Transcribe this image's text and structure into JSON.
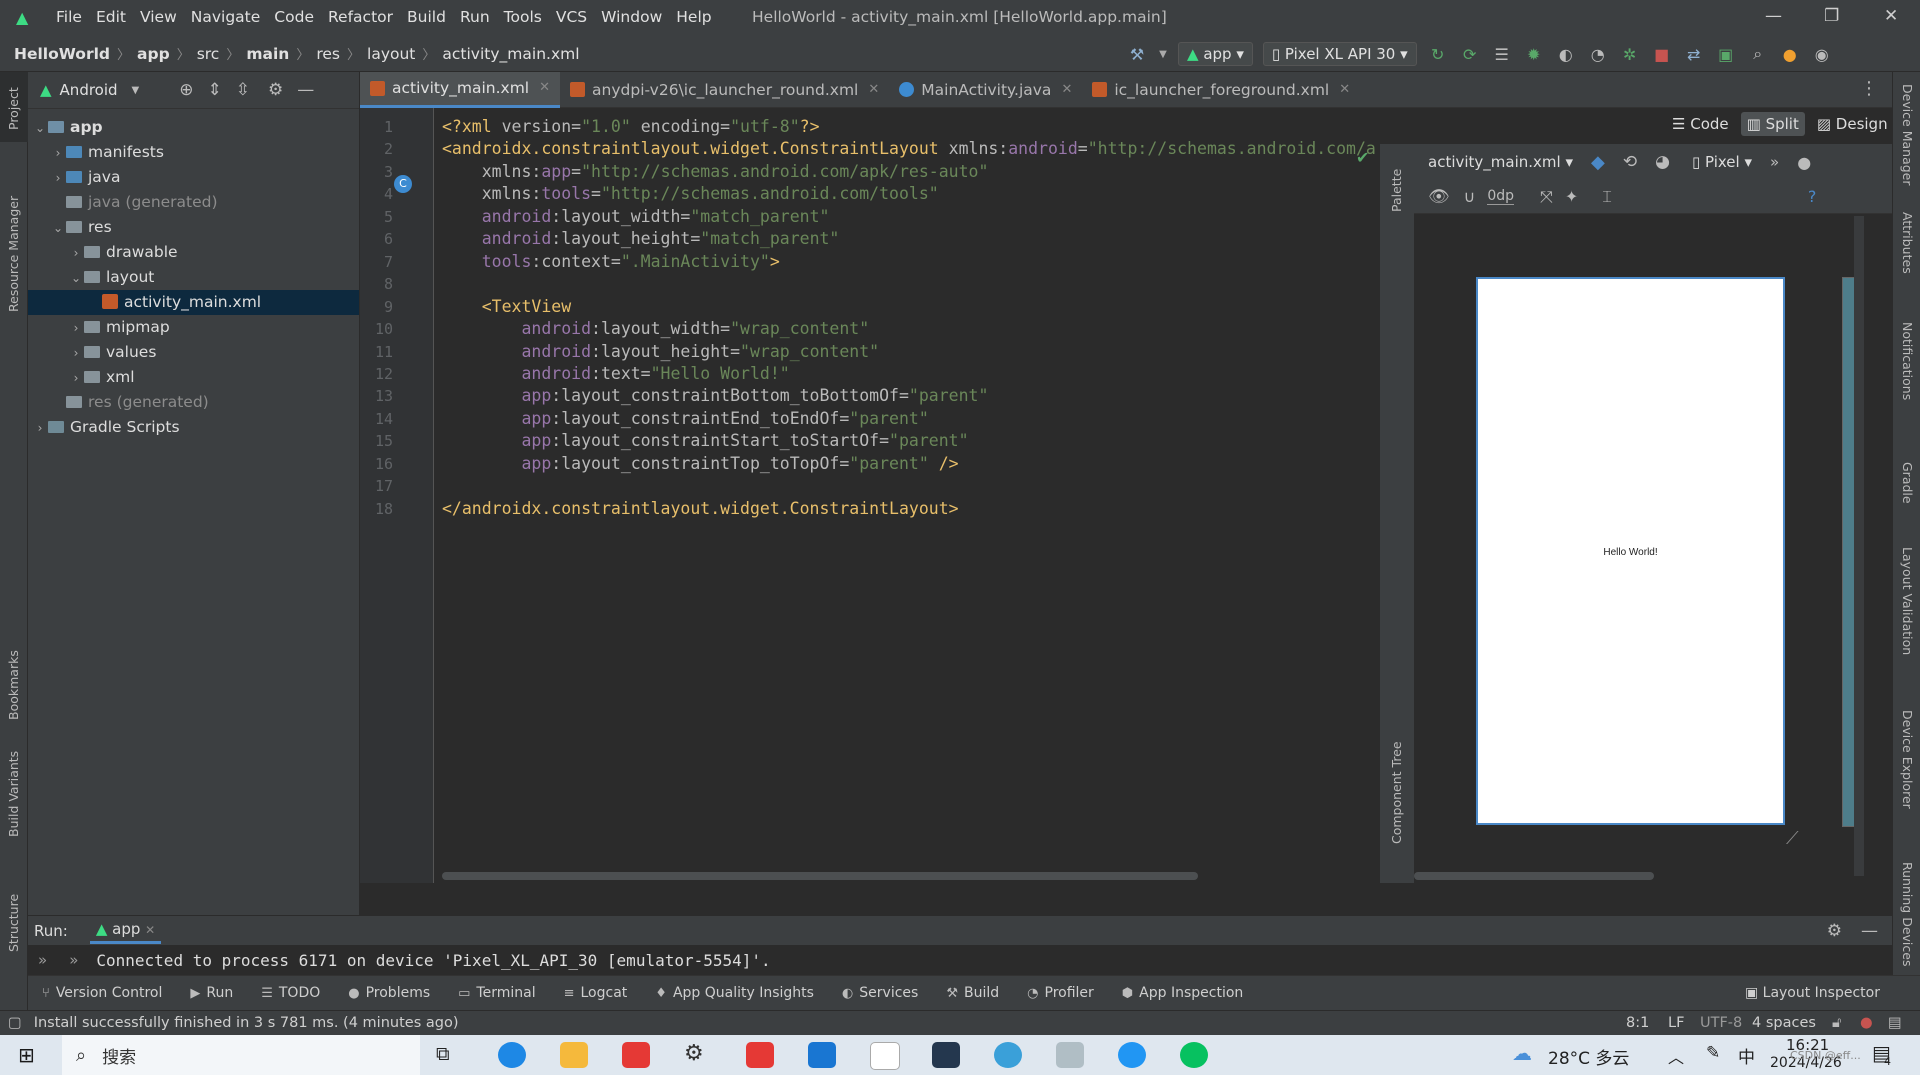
{
  "titlebar": {
    "menu": [
      "File",
      "Edit",
      "View",
      "Navigate",
      "Code",
      "Refactor",
      "Build",
      "Run",
      "Tools",
      "VCS",
      "Window",
      "Help"
    ],
    "title": "HelloWorld - activity_main.xml [HelloWorld.app.main]"
  },
  "breadcrumb": [
    "HelloWorld",
    "app",
    "src",
    "main",
    "res",
    "layout",
    "activity_main.xml"
  ],
  "toolbar": {
    "run_config": "app",
    "device": "Pixel XL API 30"
  },
  "project": {
    "view_label": "Android",
    "tree": [
      {
        "label": "app",
        "depth": 0,
        "chevron": "open",
        "kind": "module"
      },
      {
        "label": "manifests",
        "depth": 1,
        "chevron": "closed",
        "kind": "folder-blue"
      },
      {
        "label": "java",
        "depth": 1,
        "chevron": "closed",
        "kind": "folder-blue"
      },
      {
        "label": "java (generated)",
        "depth": 1,
        "chevron": "none",
        "kind": "folder-gen"
      },
      {
        "label": "res",
        "depth": 1,
        "chevron": "open",
        "kind": "folder"
      },
      {
        "label": "drawable",
        "depth": 2,
        "chevron": "closed",
        "kind": "folder"
      },
      {
        "label": "layout",
        "depth": 2,
        "chevron": "open",
        "kind": "folder"
      },
      {
        "label": "activity_main.xml",
        "depth": 3,
        "chevron": "none",
        "kind": "xml",
        "selected": true
      },
      {
        "label": "mipmap",
        "depth": 2,
        "chevron": "closed",
        "kind": "folder"
      },
      {
        "label": "values",
        "depth": 2,
        "chevron": "closed",
        "kind": "folder"
      },
      {
        "label": "xml",
        "depth": 2,
        "chevron": "closed",
        "kind": "folder"
      },
      {
        "label": "res (generated)",
        "depth": 1,
        "chevron": "none",
        "kind": "folder-gen"
      },
      {
        "label": "Gradle Scripts",
        "depth": 0,
        "chevron": "closed",
        "kind": "gradle"
      }
    ]
  },
  "tabs": [
    {
      "label": "activity_main.xml",
      "active": true,
      "icon": "xml"
    },
    {
      "label": "anydpi-v26\\ic_launcher_round.xml",
      "active": false,
      "icon": "xml"
    },
    {
      "label": "MainActivity.java",
      "active": false,
      "icon": "class"
    },
    {
      "label": "ic_launcher_foreground.xml",
      "active": false,
      "icon": "xml"
    }
  ],
  "editor": {
    "lines": [
      "1",
      "2",
      "3",
      "4",
      "5",
      "6",
      "7",
      "8",
      "9",
      "10",
      "11",
      "12",
      "13",
      "14",
      "15",
      "16",
      "17",
      "18"
    ],
    "code": [
      [
        {
          "t": "pi",
          "s": "<?xml "
        },
        {
          "t": "attr",
          "s": "version"
        },
        {
          "t": "attr",
          "s": "="
        },
        {
          "t": "val",
          "s": "\"1.0\""
        },
        {
          "t": "attr",
          "s": " encoding"
        },
        {
          "t": "attr",
          "s": "="
        },
        {
          "t": "val",
          "s": "\"utf-8\""
        },
        {
          "t": "pi",
          "s": "?>"
        }
      ],
      [
        {
          "t": "tag",
          "s": "<androidx.constraintlayout.widget.ConstraintLayout "
        },
        {
          "t": "attr",
          "s": "xmlns:"
        },
        {
          "t": "ns",
          "s": "android"
        },
        {
          "t": "attr",
          "s": "="
        },
        {
          "t": "val",
          "s": "\"http://schemas.android.com/a"
        }
      ],
      [
        {
          "t": "attr",
          "s": "    xmlns:"
        },
        {
          "t": "ns",
          "s": "app"
        },
        {
          "t": "attr",
          "s": "="
        },
        {
          "t": "val",
          "s": "\"http://schemas.android.com/apk/res-auto\""
        }
      ],
      [
        {
          "t": "attr",
          "s": "    xmlns:"
        },
        {
          "t": "ns",
          "s": "tools"
        },
        {
          "t": "attr",
          "s": "="
        },
        {
          "t": "val",
          "s": "\"http://schemas.android.com/tools\""
        }
      ],
      [
        {
          "t": "ns",
          "s": "    android"
        },
        {
          "t": "attr",
          "s": ":layout_width="
        },
        {
          "t": "val",
          "s": "\"match_parent\""
        }
      ],
      [
        {
          "t": "ns",
          "s": "    android"
        },
        {
          "t": "attr",
          "s": ":layout_height="
        },
        {
          "t": "val",
          "s": "\"match_parent\""
        }
      ],
      [
        {
          "t": "ns",
          "s": "    tools"
        },
        {
          "t": "attr",
          "s": ":context="
        },
        {
          "t": "val",
          "s": "\".MainActivity\""
        },
        {
          "t": "tag",
          "s": ">"
        }
      ],
      [],
      [
        {
          "t": "tag",
          "s": "    <TextView"
        }
      ],
      [
        {
          "t": "ns",
          "s": "        android"
        },
        {
          "t": "attr",
          "s": ":layout_width="
        },
        {
          "t": "val",
          "s": "\"wrap_content\""
        }
      ],
      [
        {
          "t": "ns",
          "s": "        android"
        },
        {
          "t": "attr",
          "s": ":layout_height="
        },
        {
          "t": "val",
          "s": "\"wrap_content\""
        }
      ],
      [
        {
          "t": "ns",
          "s": "        android"
        },
        {
          "t": "attr",
          "s": ":text="
        },
        {
          "t": "val",
          "s": "\"Hello World!\""
        }
      ],
      [
        {
          "t": "ns",
          "s": "        app"
        },
        {
          "t": "attr",
          "s": ":layout_constraintBottom_toBottomOf="
        },
        {
          "t": "val",
          "s": "\"parent\""
        }
      ],
      [
        {
          "t": "ns",
          "s": "        app"
        },
        {
          "t": "attr",
          "s": ":layout_constraintEnd_toEndOf="
        },
        {
          "t": "val",
          "s": "\"parent\""
        }
      ],
      [
        {
          "t": "ns",
          "s": "        app"
        },
        {
          "t": "attr",
          "s": ":layout_constraintStart_toStartOf="
        },
        {
          "t": "val",
          "s": "\"parent\""
        }
      ],
      [
        {
          "t": "ns",
          "s": "        app"
        },
        {
          "t": "attr",
          "s": ":layout_constraintTop_toTopOf="
        },
        {
          "t": "val",
          "s": "\"parent\""
        },
        {
          "t": "tag",
          "s": " />"
        }
      ],
      [],
      [
        {
          "t": "tag",
          "s": "</androidx.constraintlayout.widget.ConstraintLayout>"
        }
      ]
    ]
  },
  "view_modes": {
    "code": "Code",
    "split": "Split",
    "design": "Design"
  },
  "design": {
    "file_combo": "activity_main.xml",
    "device_combo": "Pixel",
    "margin": "0dp",
    "preview_text": "Hello World!",
    "palette_label": "Palette",
    "component_tree_label": "Component Tree"
  },
  "left_stripe": [
    "Project",
    "Resource Manager",
    "Bookmarks",
    "Build Variants",
    "Structure"
  ],
  "right_stripe": [
    "Device Manager",
    "Attributes",
    "Notifications",
    "Gradle",
    "Layout Validation",
    "Device Explorer",
    "Running Devices"
  ],
  "run": {
    "label": "Run:",
    "tab": "app",
    "output": "Connected to process 6171 on device 'Pixel_XL_API_30 [emulator-5554]'."
  },
  "tool_windows": [
    "Version Control",
    "Run",
    "TODO",
    "Problems",
    "Terminal",
    "Logcat",
    "App Quality Insights",
    "Services",
    "Build",
    "Profiler",
    "App Inspection"
  ],
  "layout_inspector": "Layout Inspector",
  "status": {
    "message": "Install successfully finished in 3 s 781 ms. (4 minutes ago)",
    "position": "8:1",
    "line_sep": "LF",
    "encoding": "UTF-8",
    "indent": "4 spaces"
  },
  "taskbar": {
    "search": "搜索",
    "weather": "28°C 多云",
    "ime": "中",
    "time": "16:21",
    "date": "2024/4/26",
    "notif_count": "4",
    "watermark": "CSDN @eff..."
  },
  "colors": {
    "accent": "#4a88c7",
    "android_green": "#3ddc84",
    "run_green": "#59a869",
    "stop_red": "#c75450"
  }
}
